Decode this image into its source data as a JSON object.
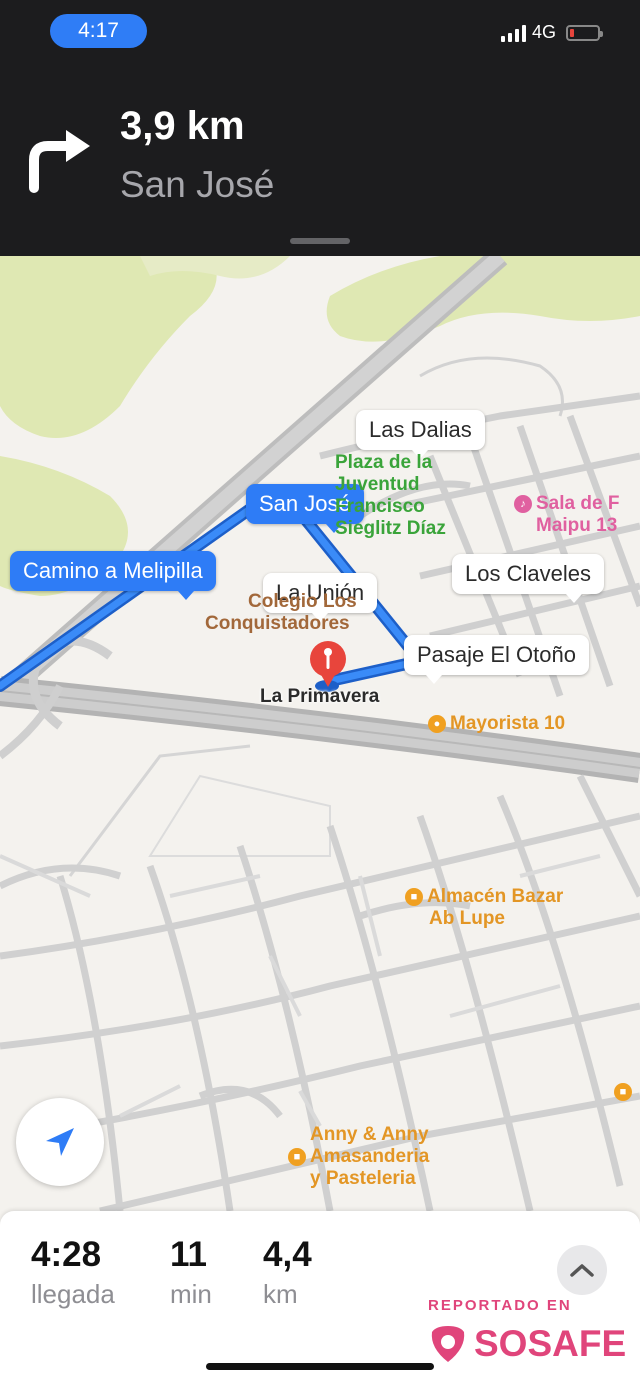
{
  "status_bar": {
    "time": "4:17",
    "network": "4G",
    "colors": {
      "time_pill": "#2f7df6",
      "battery": "#e8453c"
    }
  },
  "navigation": {
    "turn_icon": "turn-right-arrow-icon",
    "distance": "3,9 km",
    "street": "San José"
  },
  "map": {
    "street_callouts": [
      {
        "label": "Las Dalias",
        "style": "white"
      },
      {
        "label": "San José",
        "style": "blue"
      },
      {
        "label": "Camino a Melipilla",
        "style": "blue"
      },
      {
        "label": "La Unión",
        "style": "white"
      },
      {
        "label": "Los Claveles",
        "style": "white"
      },
      {
        "label": "Pasaje El Otoño",
        "style": "white"
      }
    ],
    "places": {
      "plaza": {
        "line1": "Plaza de la",
        "line2": "Juventud",
        "line3": "Francisco",
        "line4": "Sieglitz Díaz"
      },
      "sala": {
        "line1": "Sala de F",
        "line2": "Maipu 13"
      },
      "colegio": {
        "line1": "Colegio Los",
        "line2": "Conquistadores"
      },
      "mayorista": "Mayorista 10",
      "almacen": {
        "line1": "Almacén Bazar",
        "line2": "Ab Lupe"
      },
      "anny": {
        "line1": "Anny & Anny",
        "line2": "Amasanderia",
        "line3": "y Pasteleria"
      }
    },
    "destination": "La Primavera",
    "colors": {
      "route": "#2f7ef6",
      "park": "#dfe8b3",
      "destination_pin": "#e8453c"
    }
  },
  "trip_summary": {
    "arrival": {
      "value": "4:28",
      "label": "llegada"
    },
    "duration": {
      "value": "11",
      "label": "min"
    },
    "distance": {
      "value": "4,4",
      "label": "km"
    }
  },
  "branding": {
    "reported_in": "REPORTADO EN",
    "logo": "SOSAFE",
    "color": "#e0457b"
  }
}
